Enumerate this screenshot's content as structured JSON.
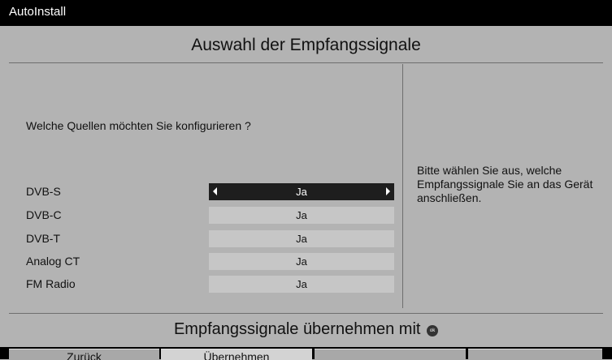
{
  "window": {
    "title": "AutoInstall"
  },
  "heading": "Auswahl der Empfangssignale",
  "question": "Welche Quellen möchten Sie konfigurieren ?",
  "rows": [
    {
      "label": "DVB-S",
      "value": "Ja",
      "selected": true
    },
    {
      "label": "DVB-C",
      "value": "Ja",
      "selected": false
    },
    {
      "label": "DVB-T",
      "value": "Ja",
      "selected": false
    },
    {
      "label": "Analog CT",
      "value": "Ja",
      "selected": false
    },
    {
      "label": "FM Radio",
      "value": "Ja",
      "selected": false
    }
  ],
  "help_text": "Bitte wählen Sie aus, welche Empfangssignale Sie an das Gerät anschließen.",
  "footer": {
    "message": "Empfangssignale übernehmen mit",
    "ok_icon_text": "ok"
  },
  "buttons": [
    {
      "label": "Zurück"
    },
    {
      "label": "Übernehmen"
    },
    {
      "label": ""
    },
    {
      "label": ""
    }
  ]
}
